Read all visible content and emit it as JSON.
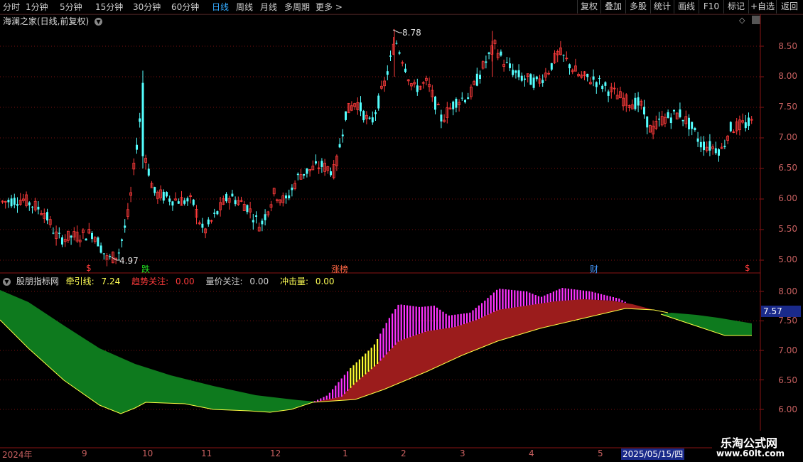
{
  "toolbar": {
    "periods": [
      "分时",
      "1分钟",
      "5分钟",
      "15分钟",
      "30分钟",
      "60分钟",
      "日线",
      "周线",
      "月线",
      "多周期",
      "更多"
    ],
    "active_period": "日线",
    "more_arrow": ">",
    "right_buttons": [
      "复权",
      "叠加",
      "多股",
      "统计",
      "画线",
      "F10",
      "标记",
      "+自选",
      "返回"
    ]
  },
  "main_chart": {
    "title": "海澜之家(日线,前复权)",
    "high_label": "8.78",
    "low_label": "4.97",
    "y_ticks": [
      "8.50",
      "8.00",
      "7.50",
      "7.00",
      "6.50",
      "6.00",
      "5.50",
      "5.00"
    ],
    "event_markers": [
      {
        "text": "$",
        "color": "#ff3b3b"
      },
      {
        "text": "跌",
        "color": "#22dd22"
      },
      {
        "text": "涨榜",
        "color": "#ff6644"
      },
      {
        "text": "财",
        "color": "#4499ff"
      },
      {
        "text": "$",
        "color": "#ff3b3b"
      }
    ],
    "colors": {
      "up": "#ff3b3b",
      "down": "#54ffff",
      "grid": "#7a1010"
    }
  },
  "indicator": {
    "name": "股朋指标网",
    "fields": [
      {
        "label": "牵引线:",
        "value": "7.24",
        "color": "#ffff55"
      },
      {
        "label": "趋势关注:",
        "value": "0.00",
        "color": "#ff3b3b"
      },
      {
        "label": "量价关注:",
        "value": "0.00",
        "color": "#c8c8c8"
      },
      {
        "label": "冲击量:",
        "value": "0.00",
        "color": "#ffff55"
      }
    ],
    "y_ticks": [
      "8.00",
      "7.50",
      "7.00",
      "6.50",
      "6.00"
    ],
    "current_value": "7.57",
    "colors": {
      "green": "#0e7a1e",
      "red": "#9b1c1c",
      "magenta": "#ff33ff",
      "yellow": "#ffff33"
    }
  },
  "date_axis": {
    "labels": [
      "2024年",
      "9",
      "10",
      "11",
      "12",
      "1",
      "2",
      "3",
      "4",
      "5"
    ],
    "cursor_date": "2025/05/15/四"
  },
  "watermark": {
    "line1": "乐淘公式网",
    "line2": "www.60lt.com"
  }
}
